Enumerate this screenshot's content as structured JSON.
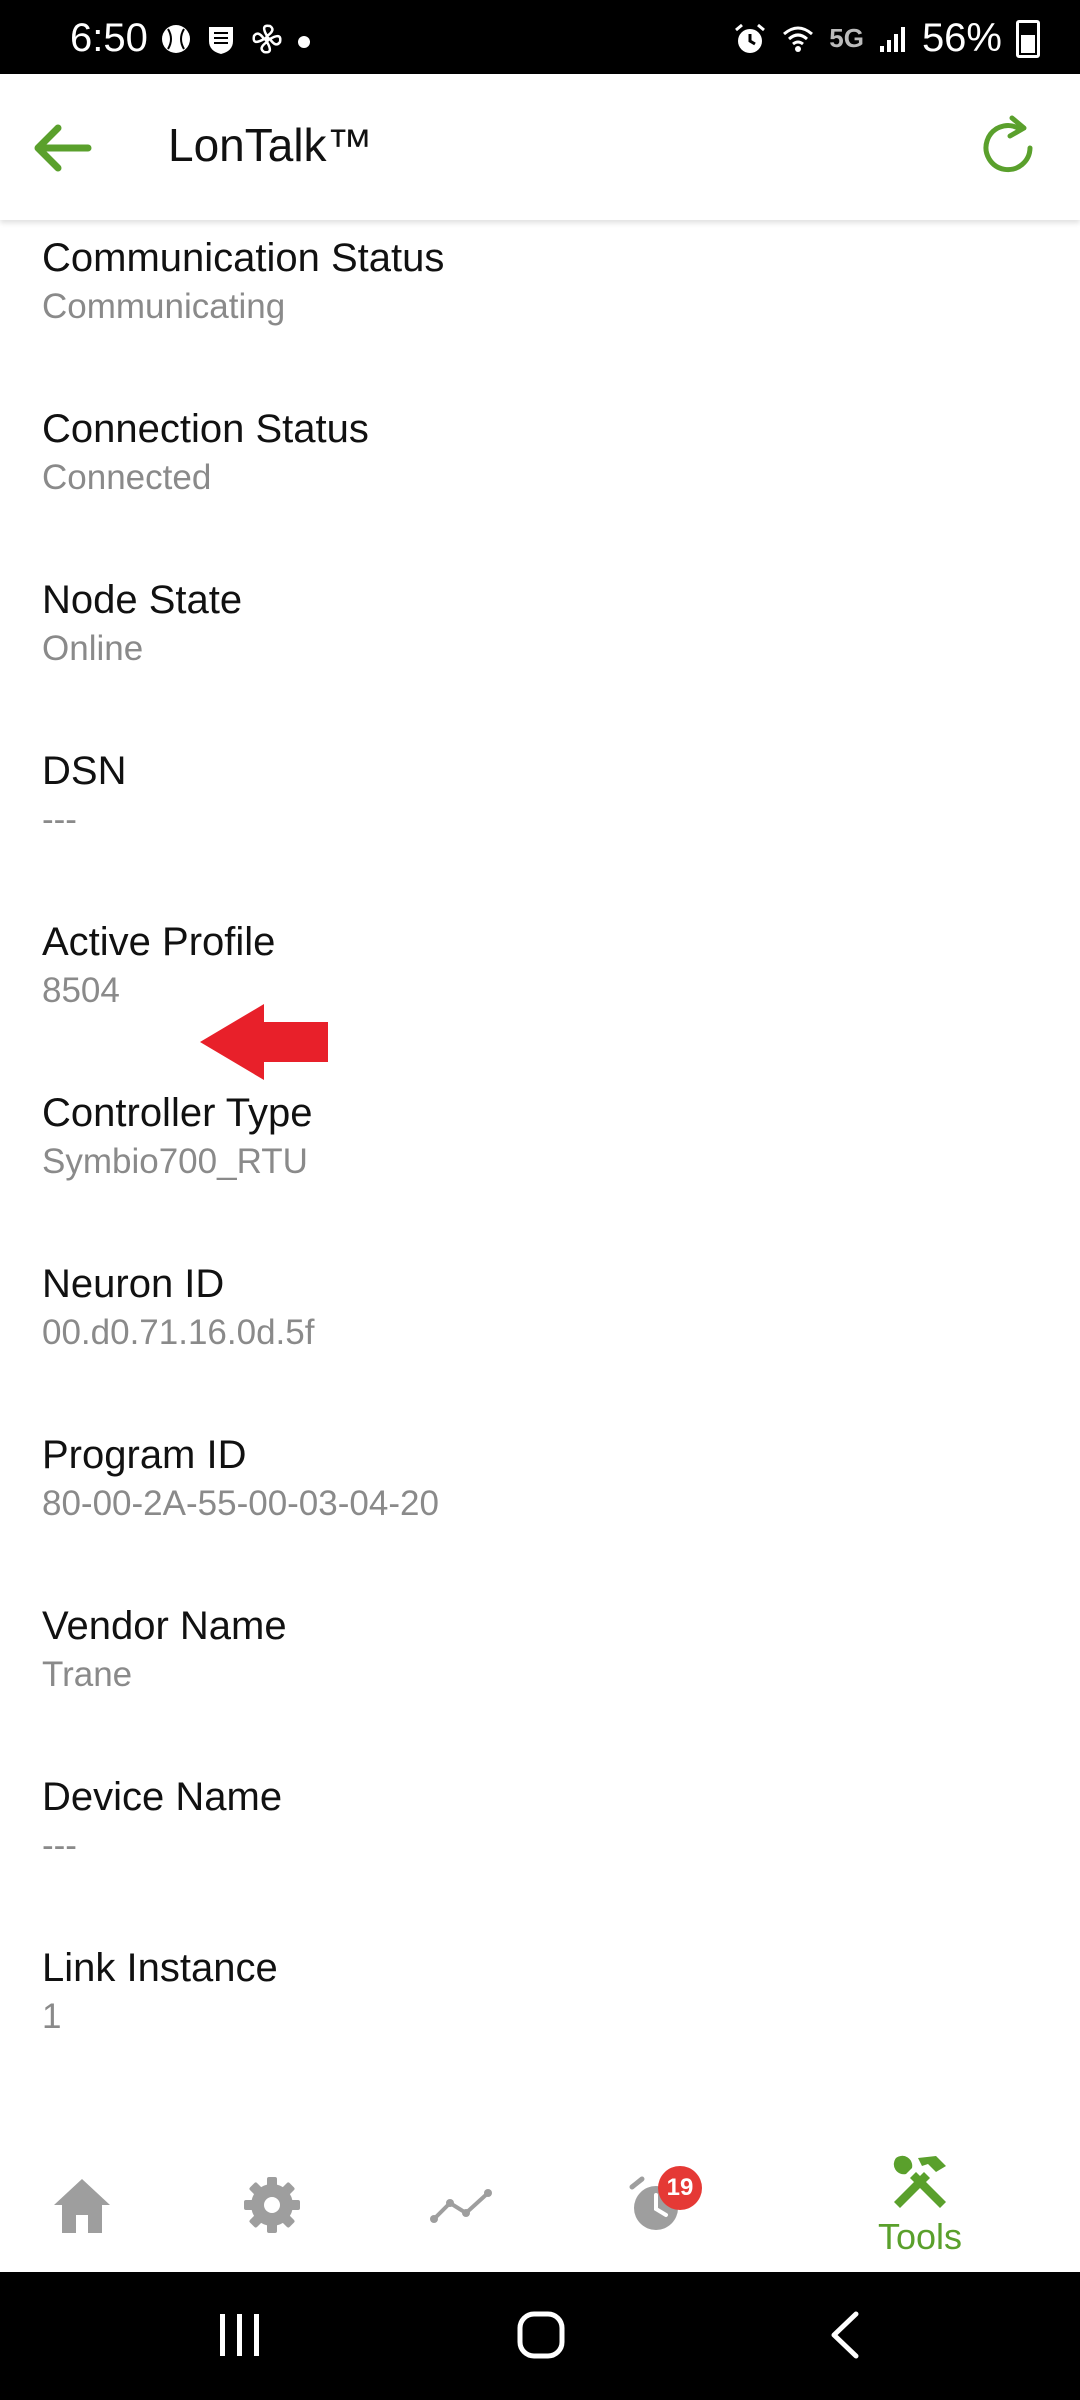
{
  "status_bar": {
    "time": "6:50",
    "network": "5G",
    "battery": "56%"
  },
  "app_bar": {
    "title": "LonTalk™"
  },
  "items": [
    {
      "label": "Communication Status",
      "value": "Communicating"
    },
    {
      "label": "Connection Status",
      "value": "Connected"
    },
    {
      "label": "Node State",
      "value": "Online"
    },
    {
      "label": "DSN",
      "value": "---"
    },
    {
      "label": "Active Profile",
      "value": "8504"
    },
    {
      "label": "Controller Type",
      "value": "Symbio700_RTU"
    },
    {
      "label": "Neuron ID",
      "value": "00.d0.71.16.0d.5f"
    },
    {
      "label": "Program ID",
      "value": "80-00-2A-55-00-03-04-20"
    },
    {
      "label": "Vendor Name",
      "value": "Trane"
    },
    {
      "label": "Device Name",
      "value": "---"
    },
    {
      "label": "Link Instance",
      "value": "1"
    }
  ],
  "bottom_nav": {
    "alarm_badge": "19",
    "tools_label": "Tools",
    "active_color": "#5aa02c",
    "inactive_color": "#9e9e9e"
  },
  "annotation": {
    "arrow_color": "#e8202a"
  }
}
